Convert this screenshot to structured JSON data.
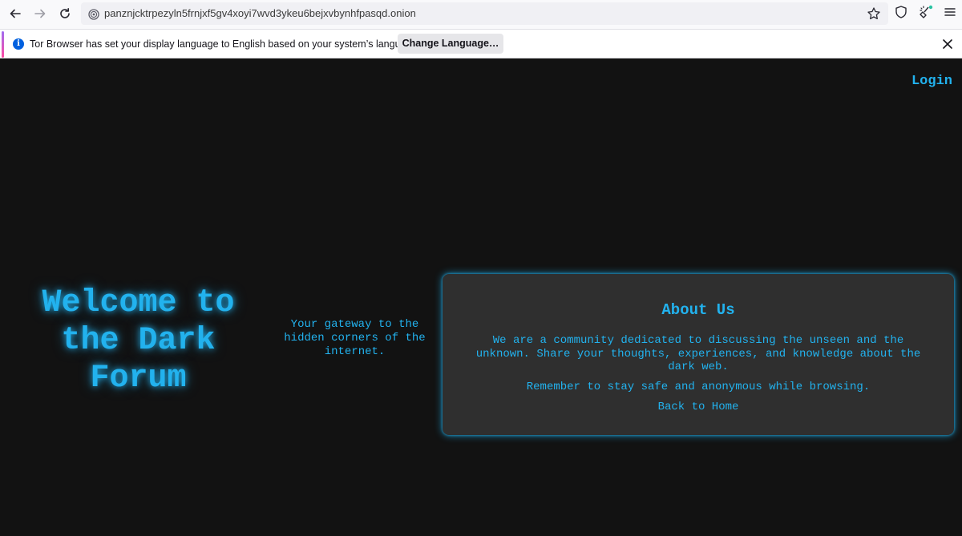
{
  "browser": {
    "url": "panznjcktrpezyln5frnjxf5gv4xoyi7wvd3ykeu6bejxvbynhfpasqd.onion",
    "notification": {
      "message": "Tor Browser has set your display language to English based on your system’s language.",
      "button_label": "Change Language…"
    },
    "icons": {
      "back": "back-arrow-icon",
      "forward": "forward-arrow-icon",
      "reload": "reload-icon",
      "onion": "onion-icon",
      "bookmark": "star-icon",
      "shield": "shield-icon",
      "new_identity": "broom-icon",
      "menu": "hamburger-menu-icon",
      "info": "info-icon",
      "close": "close-icon"
    }
  },
  "page": {
    "nav": {
      "login_label": "Login"
    },
    "hero": {
      "line1": "Welcome to",
      "line2": "the Dark",
      "line3": "Forum"
    },
    "tagline": "Your gateway to the hidden corners of the internet.",
    "about": {
      "heading": "About Us",
      "description": "We are a community dedicated to discussing the unseen and the unknown. Share your thoughts, experiences, and knowledge about the dark web.",
      "reminder": "Remember to stay safe and anonymous while browsing.",
      "back_link": "Back to Home"
    }
  },
  "colors": {
    "accent": "#22b2ee",
    "page_background": "#121212",
    "card_background": "#2f2f2f"
  }
}
